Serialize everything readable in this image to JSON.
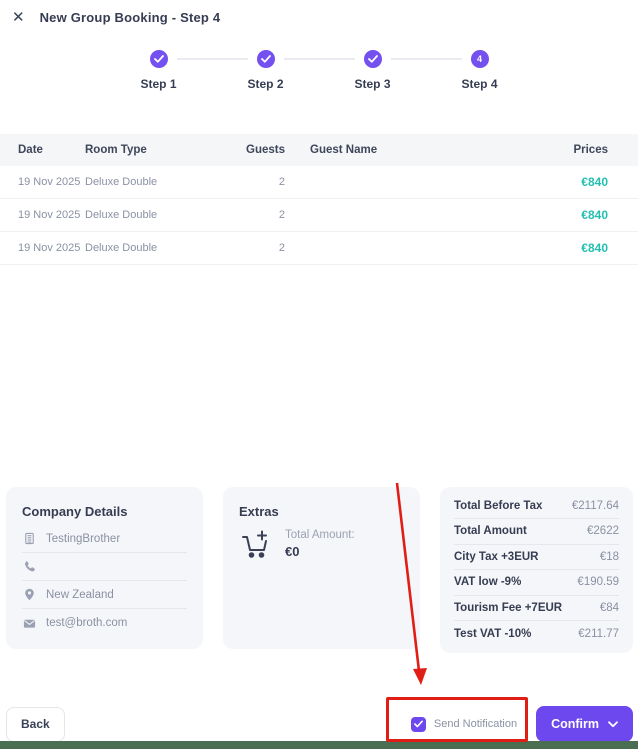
{
  "header": {
    "title": "New Group Booking - Step 4",
    "close_glyph": "✕"
  },
  "stepper": {
    "steps": [
      {
        "label": "Step 1",
        "state": "completed"
      },
      {
        "label": "Step 2",
        "state": "completed"
      },
      {
        "label": "Step 3",
        "state": "completed"
      },
      {
        "label": "Step 4",
        "state": "current",
        "glyph": "4"
      }
    ]
  },
  "table": {
    "headers": {
      "date": "Date",
      "room_type": "Room Type",
      "guests": "Guests",
      "guest_name": "Guest Name",
      "prices": "Prices"
    },
    "rows": [
      {
        "date": "19 Nov 2025",
        "room_type": "Deluxe Double",
        "guests": "2",
        "guest_name": "",
        "price": "€840"
      },
      {
        "date": "19 Nov 2025",
        "room_type": "Deluxe Double",
        "guests": "2",
        "guest_name": "",
        "price": "€840"
      },
      {
        "date": "19 Nov 2025",
        "room_type": "Deluxe Double",
        "guests": "2",
        "guest_name": "",
        "price": "€840"
      }
    ]
  },
  "company": {
    "title": "Company Details",
    "name": "TestingBrother",
    "phone": "",
    "location": "New Zealand",
    "email": "test@broth.com"
  },
  "extras": {
    "title": "Extras",
    "total_label": "Total Amount:",
    "total_value": "€0"
  },
  "totals": {
    "rows": [
      {
        "label": "Total Before Tax",
        "value": "€2117.64"
      },
      {
        "label": "Total Amount",
        "value": "€2622"
      },
      {
        "label": "City Tax +3EUR",
        "value": "€18"
      },
      {
        "label": "VAT low -9%",
        "value": "€190.59"
      },
      {
        "label": "Tourism Fee +7EUR",
        "value": "€84"
      },
      {
        "label": "Test VAT -10%",
        "value": "€211.77"
      }
    ]
  },
  "footer": {
    "back_label": "Back",
    "notification_label": "Send Notification",
    "notification_checked": true,
    "confirm_label": "Confirm"
  },
  "icons": {
    "close": "✕",
    "step_check": "✓",
    "company": "building-icon",
    "phone": "phone-icon",
    "location": "location-pin-icon",
    "email": "envelope-icon",
    "extras": "cart-plus-icon",
    "confirm_chevron": "chevron-down-icon",
    "checkbox_check": "✓"
  },
  "colors": {
    "accent_step": "#7450f1",
    "accent_button": "#6d48ee",
    "price": "#23bfb1",
    "annotation_red": "#e01e15",
    "bottom_bar_green": "#496e51",
    "card_bg": "#f5f6f9"
  }
}
